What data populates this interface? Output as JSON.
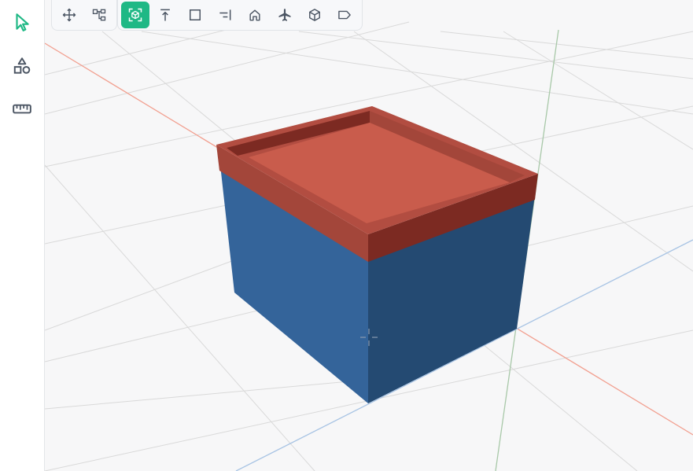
{
  "colors": {
    "accent": "#1fb885",
    "icon": "#4b5563",
    "box_side_left": "#34649a",
    "box_side_right": "#244a72",
    "lid_top": "#c95c4c",
    "lid_rim": "#7c2a22",
    "axis_x": "#f2a090",
    "axis_y": "#a8c8a8",
    "axis_z": "#a8c4e4",
    "grid": "#d9d9d9",
    "background": "#f7f7f8"
  },
  "left_toolbar": [
    {
      "name": "select-tool",
      "icon": "cursor-arrow-icon",
      "active": true
    },
    {
      "name": "shapes-tool",
      "icon": "shapes-icon",
      "active": false
    },
    {
      "name": "measure-tool",
      "icon": "ruler-icon",
      "active": false
    }
  ],
  "top_toolbar": {
    "group1": [
      {
        "name": "move-view",
        "icon": "move-arrows-icon",
        "active": false
      },
      {
        "name": "hierarchy-view",
        "icon": "hierarchy-icon",
        "active": false
      }
    ],
    "group2": [
      {
        "name": "view-perspective",
        "icon": "cube-focus-icon",
        "active": true
      },
      {
        "name": "view-top",
        "icon": "arrow-up-bar-icon",
        "active": false
      },
      {
        "name": "view-front",
        "icon": "square-icon",
        "active": false
      },
      {
        "name": "view-right",
        "icon": "align-right-icon",
        "active": false
      },
      {
        "name": "view-home",
        "icon": "home-icon",
        "active": false
      },
      {
        "name": "view-fly",
        "icon": "airplane-icon",
        "active": false
      },
      {
        "name": "view-iso",
        "icon": "cube-outline-icon",
        "active": false
      },
      {
        "name": "view-label",
        "icon": "tag-icon",
        "active": false
      }
    ]
  }
}
